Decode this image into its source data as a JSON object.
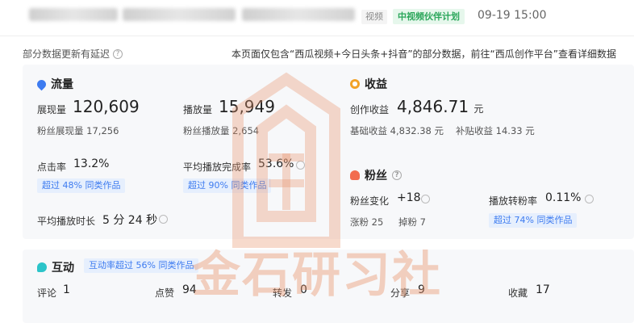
{
  "header": {
    "category_tag": "视频",
    "program_tag": "中视频伙伴计划",
    "datetime": "09-19 15:00"
  },
  "notice": {
    "delay": "部分数据更新有延迟",
    "scope": "本页面仅包含“西瓜视频+今日头条+抖音”的部分数据，前往“西瓜创作平台”查看详细数据"
  },
  "traffic": {
    "title": "流量",
    "impressions_label": "展现量",
    "impressions_value": "120,609",
    "fan_impressions": "粉丝展现量 17,256",
    "plays_label": "播放量",
    "plays_value": "15,949",
    "fan_plays": "粉丝播放量 2,654",
    "ctr_label": "点击率",
    "ctr_value": "13.2%",
    "ctr_badge": "超过 48% 同类作品",
    "completion_label": "平均播放完成率",
    "completion_value": "53.6%",
    "completion_badge": "超过 90% 同类作品",
    "avg_duration_label": "平均播放时长",
    "avg_duration_value": "5 分 24 秒"
  },
  "income": {
    "title": "收益",
    "creation_label": "创作收益",
    "creation_value": "4,846.71",
    "currency": "元",
    "base": "基础收益 4,832.38 元",
    "bonus": "补贴收益 14.33 元"
  },
  "fans": {
    "title": "粉丝",
    "change_label": "粉丝变化",
    "change_value": "+18",
    "gained": "涨粉 25",
    "lost": "掉粉 7",
    "conversion_label": "播放转粉率",
    "conversion_value": "0.11%",
    "conversion_badge": "超过 74% 同类作品"
  },
  "interaction": {
    "title": "互动",
    "badge": "互动率超过 56% 同类作品",
    "comments_label": "评论",
    "comments_value": "1",
    "likes_label": "点赞",
    "likes_value": "94",
    "shares_label": "转发",
    "shares_value": "0",
    "distribute_label": "分享",
    "distribute_value": "9",
    "favorites_label": "收藏",
    "favorites_value": "17"
  },
  "watermark": {
    "text": "金石研习社"
  },
  "colors": {
    "accent_blue": "#3d7bf0",
    "accent_green": "#2aa65a",
    "watermark": "#e9946c"
  }
}
